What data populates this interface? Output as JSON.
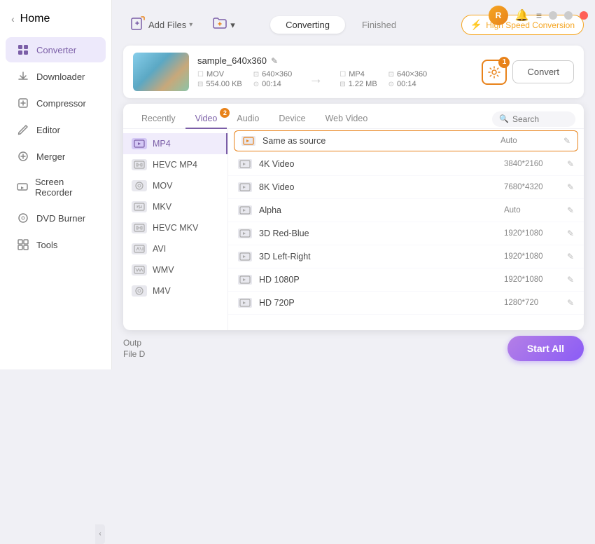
{
  "window": {
    "title": "Converter"
  },
  "sidebar": {
    "back_label": "Home",
    "items": [
      {
        "id": "converter",
        "label": "Converter",
        "active": true,
        "icon": "⊞"
      },
      {
        "id": "downloader",
        "label": "Downloader",
        "active": false,
        "icon": "↓"
      },
      {
        "id": "compressor",
        "label": "Compressor",
        "active": false,
        "icon": "⊡"
      },
      {
        "id": "editor",
        "label": "Editor",
        "active": false,
        "icon": "✂"
      },
      {
        "id": "merger",
        "label": "Merger",
        "active": false,
        "icon": "⊕"
      },
      {
        "id": "screen-recorder",
        "label": "Screen Recorder",
        "active": false,
        "icon": "⊙"
      },
      {
        "id": "dvd-burner",
        "label": "DVD Burner",
        "active": false,
        "icon": "⊚"
      },
      {
        "id": "tools",
        "label": "Tools",
        "active": false,
        "icon": "⊞"
      }
    ]
  },
  "toolbar": {
    "add_file_label": "Add Files",
    "add_folder_label": "Add Folder"
  },
  "tabs": {
    "converting_label": "Converting",
    "finished_label": "Finished",
    "active": "converting"
  },
  "hsc": {
    "label": "High Speed Conversion"
  },
  "file": {
    "name": "sample_640x360",
    "source_format": "MOV",
    "source_size": "554.00 KB",
    "source_resolution": "640×360",
    "source_duration": "00:14",
    "target_format": "MP4",
    "target_size": "1.22 MB",
    "target_resolution": "640×360",
    "target_duration": "00:14",
    "convert_btn_label": "Convert"
  },
  "format_panel": {
    "tabs": [
      {
        "id": "recently",
        "label": "Recently"
      },
      {
        "id": "video",
        "label": "Video",
        "active": true
      },
      {
        "id": "audio",
        "label": "Audio"
      },
      {
        "id": "device",
        "label": "Device"
      },
      {
        "id": "web-video",
        "label": "Web Video"
      }
    ],
    "search_placeholder": "Search",
    "formats": [
      {
        "id": "mp4",
        "label": "MP4",
        "active": true
      },
      {
        "id": "hevc-mp4",
        "label": "HEVC MP4",
        "active": false
      },
      {
        "id": "mov",
        "label": "MOV",
        "active": false
      },
      {
        "id": "mkv",
        "label": "MKV",
        "active": false
      },
      {
        "id": "hevc-mkv",
        "label": "HEVC MKV",
        "active": false
      },
      {
        "id": "avi",
        "label": "AVI",
        "active": false
      },
      {
        "id": "wmv",
        "label": "WMV",
        "active": false
      },
      {
        "id": "m4v",
        "label": "M4V",
        "active": false
      }
    ],
    "qualities": [
      {
        "id": "same-as-source",
        "label": "Same as source",
        "res": "Auto",
        "active": true
      },
      {
        "id": "4k-video",
        "label": "4K Video",
        "res": "3840*2160",
        "active": false
      },
      {
        "id": "8k-video",
        "label": "8K Video",
        "res": "7680*4320",
        "active": false
      },
      {
        "id": "alpha",
        "label": "Alpha",
        "res": "Auto",
        "active": false
      },
      {
        "id": "3d-red-blue",
        "label": "3D Red-Blue",
        "res": "1920*1080",
        "active": false
      },
      {
        "id": "3d-left-right",
        "label": "3D Left-Right",
        "res": "1920*1080",
        "active": false
      },
      {
        "id": "hd-1080p",
        "label": "HD 1080P",
        "res": "1920*1080",
        "active": false
      },
      {
        "id": "hd-720p",
        "label": "HD 720P",
        "res": "1280*720",
        "active": false
      }
    ]
  },
  "bottom": {
    "output_label": "Outp",
    "file_label": "File D",
    "start_all_label": "Start All"
  },
  "badges": {
    "settings": "1",
    "video_tab": "2"
  },
  "icons": {
    "back": "‹",
    "add_file": "🖹",
    "add_folder": "⊕",
    "arrow_right": "→",
    "search": "🔍",
    "edit": "✎",
    "lightning": "⚡",
    "gear": "⚙",
    "chevron_left": "‹",
    "notif": "🔔"
  }
}
